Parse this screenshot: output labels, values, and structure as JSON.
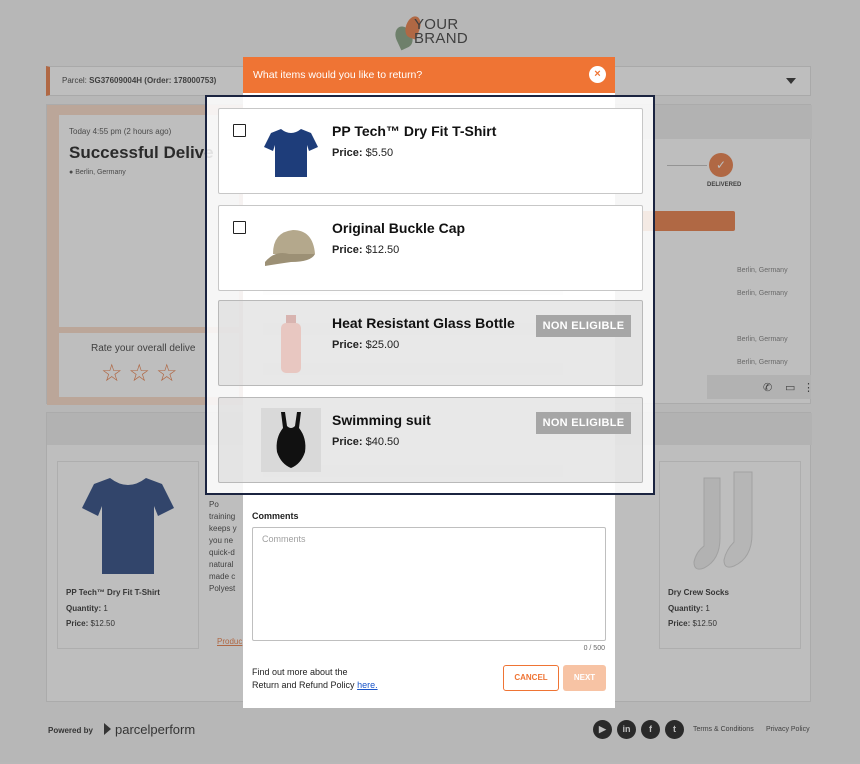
{
  "brand": {
    "name_line1": "YOUR",
    "name_line2": "BRAND"
  },
  "parcel": {
    "label_prefix": "Parcel:",
    "label_value": "SG37609004H (Order: 178000753)"
  },
  "status": {
    "time": "Today 4:55 pm (2 hours ago)",
    "headline": "Successful Delive",
    "location": "Berlin, Germany",
    "rate_prompt": "Rate your overall delive",
    "stars": "☆☆☆",
    "delivered_label": "DELIVERED",
    "history_locations": [
      "Berlin, Germany",
      "Berlin, Germany",
      "Berlin, Germany",
      "Berlin, Germany"
    ]
  },
  "background_products": [
    {
      "name": "PP Tech™ Dry Fit T-Shirt",
      "quantity_label": "Quantity:",
      "quantity": "1",
      "price_label": "Price:",
      "price": "$12.50"
    },
    {
      "name": "Dry Crew Socks",
      "quantity_label": "Quantity:",
      "quantity": "1",
      "price_label": "Price:",
      "price": "$12.50"
    }
  ],
  "background_desc_lines": [
    "Po",
    "training",
    "keeps y",
    "you ne",
    "quick-d",
    "natural",
    "made c",
    "Polyest"
  ],
  "background_product_link": "Produc",
  "modal": {
    "title": "What items would you like to return?",
    "close_icon": "×",
    "items": [
      {
        "name": "PP Tech™ Dry Fit T-Shirt",
        "price_label": "Price:",
        "price": "$5.50",
        "eligible": true,
        "icon": "tshirt-icon"
      },
      {
        "name": "Original Buckle Cap",
        "price_label": "Price:",
        "price": "$12.50",
        "eligible": true,
        "icon": "cap-icon"
      },
      {
        "name": "Heat Resistant Glass Bottle",
        "price_label": "Price:",
        "price": "$25.00",
        "eligible": false,
        "badge": "NON ELIGIBLE",
        "icon": "bottle-icon"
      },
      {
        "name": "Swimming suit",
        "price_label": "Price:",
        "price": "$40.50",
        "eligible": false,
        "badge": "NON ELIGIBLE",
        "icon": "swimsuit-icon"
      }
    ],
    "comments_label": "Comments",
    "comments_placeholder": "Comments",
    "comments_value": "",
    "comments_counter": "0 / 500",
    "policy_line1": "Find out more about the",
    "policy_line2": "Return and Refund Policy",
    "policy_link": "here.",
    "cancel_label": "CANCEL",
    "next_label": "NEXT"
  },
  "footer": {
    "powered_by": "Powered by",
    "provider": "parcelperform",
    "social_icons": [
      "youtube-icon",
      "linkedin-icon",
      "facebook-icon",
      "twitter-icon"
    ],
    "terms": "Terms & Conditions",
    "privacy": "Privacy Policy"
  },
  "colors": {
    "accent": "#ef7434",
    "accent_light": "#f7c3a4",
    "panel_border": "#1b2440",
    "badge_grey": "#a6a6a6"
  }
}
